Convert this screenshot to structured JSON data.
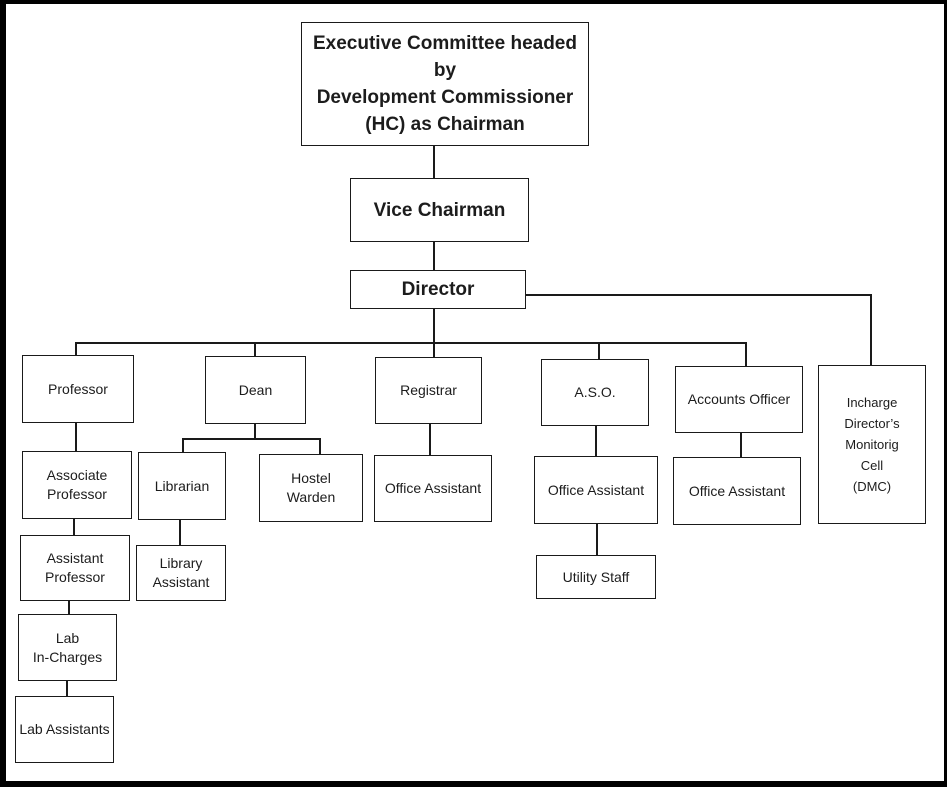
{
  "diagram": {
    "type": "organization-chart",
    "nodes": {
      "executive_committee": "Executive Committee headed by\nDevelopment Commissioner\n(HC) as Chairman",
      "vice_chairman": "Vice Chairman",
      "director": "Director",
      "professor": "Professor",
      "associate_professor": "Associate\nProfessor",
      "assistant_professor": "Assistant\nProfessor",
      "lab_in_charges": "Lab\nIn-Charges",
      "lab_assistants": "Lab Assistants",
      "dean": "Dean",
      "librarian": "Librarian",
      "hostel_warden": "Hostel\nWarden",
      "library_assistant": "Library\nAssistant",
      "registrar": "Registrar",
      "registrar_office_assistant": "Office Assistant",
      "aso": "A.S.O.",
      "aso_office_assistant": "Office Assistant",
      "utility_staff": "Utility Staff",
      "accounts_officer": "Accounts Officer",
      "accounts_office_assistant": "Office Assistant",
      "dmc": "Incharge\nDirector’s\nMonitorig\nCell\n(DMC)"
    },
    "edges": [
      [
        "executive_committee",
        "vice_chairman"
      ],
      [
        "vice_chairman",
        "director"
      ],
      [
        "director",
        "professor"
      ],
      [
        "director",
        "dean"
      ],
      [
        "director",
        "registrar"
      ],
      [
        "director",
        "aso"
      ],
      [
        "director",
        "accounts_officer"
      ],
      [
        "director",
        "dmc"
      ],
      [
        "professor",
        "associate_professor"
      ],
      [
        "associate_professor",
        "assistant_professor"
      ],
      [
        "assistant_professor",
        "lab_in_charges"
      ],
      [
        "lab_in_charges",
        "lab_assistants"
      ],
      [
        "dean",
        "librarian"
      ],
      [
        "dean",
        "hostel_warden"
      ],
      [
        "librarian",
        "library_assistant"
      ],
      [
        "registrar",
        "registrar_office_assistant"
      ],
      [
        "aso",
        "aso_office_assistant"
      ],
      [
        "aso_office_assistant",
        "utility_staff"
      ],
      [
        "accounts_officer",
        "accounts_office_assistant"
      ]
    ]
  }
}
